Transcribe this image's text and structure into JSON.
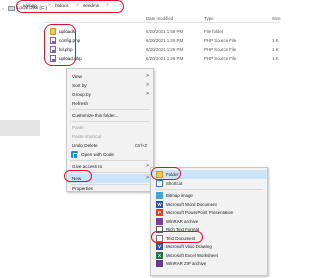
{
  "left_pane": {
    "expand_arrow": ">",
    "drive_label": "Local Disk (C:)"
  },
  "breadcrumb": {
    "items": [
      "xampp",
      "htdocs",
      "seedms"
    ],
    "separator": ">"
  },
  "columns": {
    "date_modified": "Date modified",
    "type": "Type",
    "size": "Size"
  },
  "files": [
    {
      "name": "uploads",
      "date": "6/20/2021 1:58 PM",
      "type": "File folder",
      "size": "",
      "icon": "folder-icon"
    },
    {
      "name": "config.php",
      "date": "6/20/2021 1:26 PM",
      "type": "PHP Source File",
      "size": "1 K",
      "icon": "php-file-icon"
    },
    {
      "name": "lol.php",
      "date": "6/20/2021 1:25 PM",
      "type": "PHP Source File",
      "size": "1 K",
      "icon": "php-file-icon"
    },
    {
      "name": "upload.php",
      "date": "6/20/2021 1:26 PM",
      "type": "PHP Source File",
      "size": "1 K",
      "icon": "php-file-icon"
    }
  ],
  "context_menu": {
    "view": "View",
    "sort_by": "Sort by",
    "group_by": "Group by",
    "refresh": "Refresh",
    "customize": "Customize this folder...",
    "paste": "Paste",
    "paste_shortcut": "Paste shortcut",
    "undo_delete": "Undo Delete",
    "undo_shortcut": "Ctrl+Z",
    "open_with_code": "Open with Code",
    "give_access": "Give access to",
    "new": "New",
    "properties": "Properties",
    "arrow": ">"
  },
  "new_submenu": {
    "folder": "Folder",
    "shortcut": "Shortcut",
    "bitmap": "Bitmap image",
    "word": "Microsoft Word Document",
    "powerpoint": "Microsoft PowerPoint Presentation",
    "winrar": "WinRAR archive",
    "rtf": "Rich Text Format",
    "text": "Text Document",
    "visio": "Microsoft Visio Drawing",
    "excel": "Microsoft Excel Worksheet",
    "winrar_zip": "WinRAR ZIP archive"
  },
  "colors": {
    "highlight": "#cce4f7",
    "annotation_red": "#e0112d"
  }
}
